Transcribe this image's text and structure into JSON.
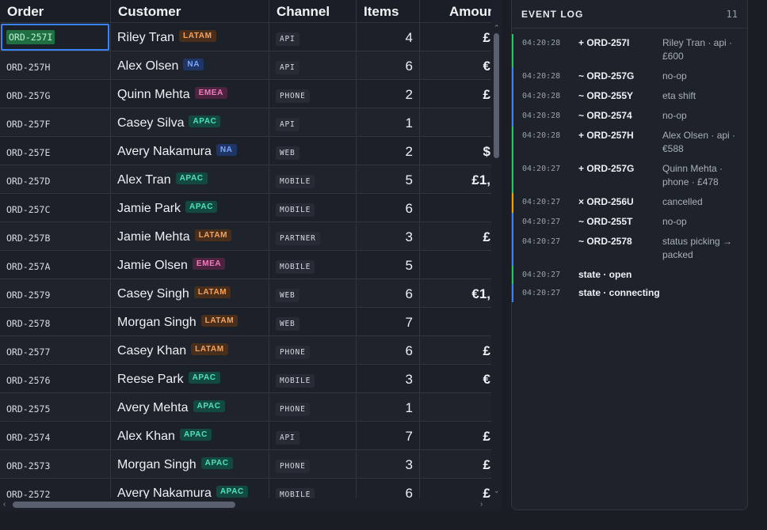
{
  "grid": {
    "columns": [
      "Order",
      "Customer",
      "Channel",
      "Items",
      "Amoun"
    ],
    "selected_order": "ORD-257I",
    "rows": [
      {
        "order": "ORD-257I",
        "customer": "Riley Tran",
        "region": "LATAM",
        "channel": "API",
        "items": "4",
        "amount": "£"
      },
      {
        "order": "ORD-257H",
        "customer": "Alex Olsen",
        "region": "NA",
        "channel": "API",
        "items": "6",
        "amount": "€"
      },
      {
        "order": "ORD-257G",
        "customer": "Quinn Mehta",
        "region": "EMEA",
        "channel": "PHONE",
        "items": "2",
        "amount": "£"
      },
      {
        "order": "ORD-257F",
        "customer": "Casey Silva",
        "region": "APAC",
        "channel": "API",
        "items": "1",
        "amount": ""
      },
      {
        "order": "ORD-257E",
        "customer": "Avery Nakamura",
        "region": "NA",
        "channel": "WEB",
        "items": "2",
        "amount": "$"
      },
      {
        "order": "ORD-257D",
        "customer": "Alex Tran",
        "region": "APAC",
        "channel": "MOBILE",
        "items": "5",
        "amount": "£1,"
      },
      {
        "order": "ORD-257C",
        "customer": "Jamie Park",
        "region": "APAC",
        "channel": "MOBILE",
        "items": "6",
        "amount": ""
      },
      {
        "order": "ORD-257B",
        "customer": "Jamie Mehta",
        "region": "LATAM",
        "channel": "PARTNER",
        "items": "3",
        "amount": "£"
      },
      {
        "order": "ORD-257A",
        "customer": "Jamie Olsen",
        "region": "EMEA",
        "channel": "MOBILE",
        "items": "5",
        "amount": ""
      },
      {
        "order": "ORD-2579",
        "customer": "Casey Singh",
        "region": "LATAM",
        "channel": "WEB",
        "items": "6",
        "amount": "€1,"
      },
      {
        "order": "ORD-2578",
        "customer": "Morgan Singh",
        "region": "LATAM",
        "channel": "WEB",
        "items": "7",
        "amount": ""
      },
      {
        "order": "ORD-2577",
        "customer": "Casey Khan",
        "region": "LATAM",
        "channel": "PHONE",
        "items": "6",
        "amount": "£"
      },
      {
        "order": "ORD-2576",
        "customer": "Reese Park",
        "region": "APAC",
        "channel": "MOBILE",
        "items": "3",
        "amount": "€"
      },
      {
        "order": "ORD-2575",
        "customer": "Avery Mehta",
        "region": "APAC",
        "channel": "PHONE",
        "items": "1",
        "amount": ""
      },
      {
        "order": "ORD-2574",
        "customer": "Alex Khan",
        "region": "APAC",
        "channel": "API",
        "items": "7",
        "amount": "£"
      },
      {
        "order": "ORD-2573",
        "customer": "Morgan Singh",
        "region": "APAC",
        "channel": "PHONE",
        "items": "3",
        "amount": "£"
      },
      {
        "order": "ORD-2572",
        "customer": "Avery Nakamura",
        "region": "APAC",
        "channel": "MOBILE",
        "items": "6",
        "amount": "£"
      }
    ]
  },
  "event_log": {
    "title": "EVENT LOG",
    "count": "11",
    "events": [
      {
        "kind": "add",
        "time": "04:20:28",
        "what": "+ ORD-257I",
        "detail": "Riley Tran · api · £600"
      },
      {
        "kind": "upd",
        "time": "04:20:28",
        "what": "~ ORD-257G",
        "detail": "no-op"
      },
      {
        "kind": "upd",
        "time": "04:20:28",
        "what": "~ ORD-255Y",
        "detail": "eta shift"
      },
      {
        "kind": "upd",
        "time": "04:20:28",
        "what": "~ ORD-2574",
        "detail": "no-op"
      },
      {
        "kind": "add",
        "time": "04:20:28",
        "what": "+ ORD-257H",
        "detail": "Alex Olsen · api · €588"
      },
      {
        "kind": "add",
        "time": "04:20:27",
        "what": "+ ORD-257G",
        "detail": "Quinn Mehta · phone · £478"
      },
      {
        "kind": "del",
        "time": "04:20:27",
        "what": "× ORD-256U",
        "detail": "cancelled"
      },
      {
        "kind": "upd",
        "time": "04:20:27",
        "what": "~ ORD-255T",
        "detail": "no-op"
      },
      {
        "kind": "upd",
        "time": "04:20:27",
        "what": "~ ORD-2578",
        "detail": "status picking → packed"
      },
      {
        "kind": "add",
        "time": "04:20:27",
        "what": "state · open",
        "detail": ""
      },
      {
        "kind": "upd",
        "time": "04:20:27",
        "what": "state · connecting",
        "detail": ""
      }
    ]
  },
  "colors": {
    "accent": "#3b82f6",
    "add": "#22c55e",
    "update": "#3b82f6",
    "delete": "#f59e0b"
  },
  "icons": {
    "scroll_up": "chevron-up-icon",
    "scroll_down": "chevron-down-icon",
    "scroll_left": "chevron-left-icon",
    "scroll_right": "chevron-right-icon"
  }
}
